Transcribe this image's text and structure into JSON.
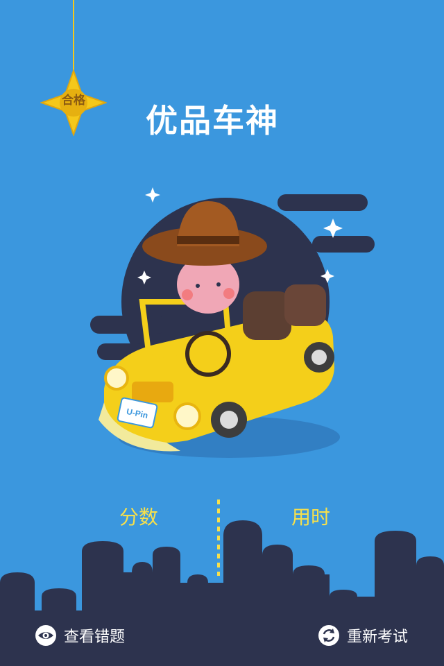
{
  "badge": {
    "label": "合格"
  },
  "header": {
    "title": "优品车神"
  },
  "stats": {
    "score_label": "分数",
    "time_label": "用时"
  },
  "license_plate": "U-Pin",
  "actions": {
    "review_wrong": "查看错题",
    "retake_exam": "重新考试"
  },
  "colors": {
    "background": "#3b97de",
    "accent_yellow": "#f7e04b",
    "skyline": "#2d334e",
    "badge": "#f5c81a"
  },
  "icons": {
    "review": "eye-icon",
    "retake": "refresh-icon"
  }
}
